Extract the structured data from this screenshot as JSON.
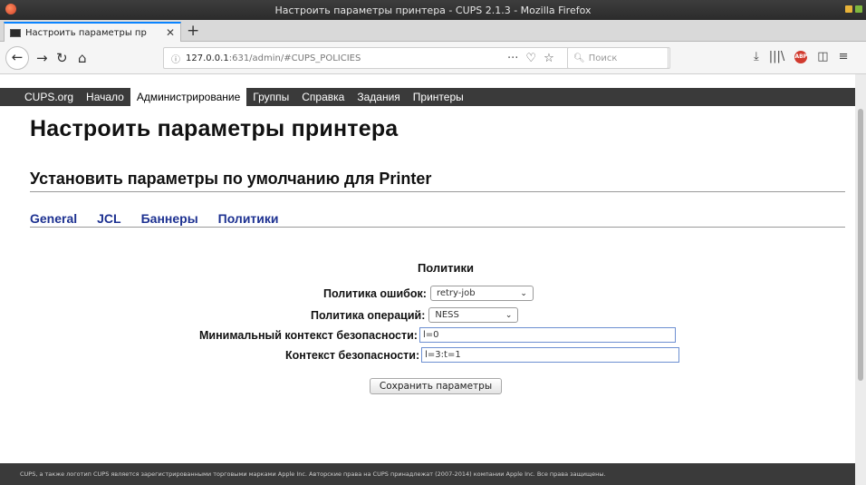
{
  "window": {
    "title": "Настроить параметры принтера - CUPS 2.1.3 - Mozilla Firefox"
  },
  "browser": {
    "tab_title": "Настроить параметры пр",
    "new_tab": "+",
    "url_host": "127.0.0.1",
    "url_rest": ":631/admin/#CUPS_POLICIES",
    "search_placeholder": "Поиск"
  },
  "cups_nav": [
    {
      "label": "CUPS.org"
    },
    {
      "label": "Начало"
    },
    {
      "label": "Администрирование",
      "active": true
    },
    {
      "label": "Группы"
    },
    {
      "label": "Справка"
    },
    {
      "label": "Задания"
    },
    {
      "label": "Принтеры"
    }
  ],
  "page": {
    "title": "Настроить параметры принтера",
    "subtitle": "Установить параметры по умолчанию для Printer",
    "tabs": [
      "General",
      "JCL",
      "Баннеры",
      "Политики"
    ]
  },
  "form": {
    "title": "Политики",
    "error_policy_label": "Политика ошибок:",
    "error_policy_value": "retry-job",
    "op_policy_label": "Политика операций:",
    "op_policy_value": "NESS",
    "min_context_label": "Минимальный контекст безопасности:",
    "min_context_value": "l=0",
    "context_label": "Контекст безопасности:",
    "context_value": "l=3:t=1",
    "save_label": "Сохранить параметры"
  },
  "footer": {
    "text": "CUPS, а также логотип CUPS является зарегистрированными торговыми марками Apple Inc. Авторские права на CUPS принадлежат (2007-2014) компании Apple Inc. Все права защищены."
  }
}
